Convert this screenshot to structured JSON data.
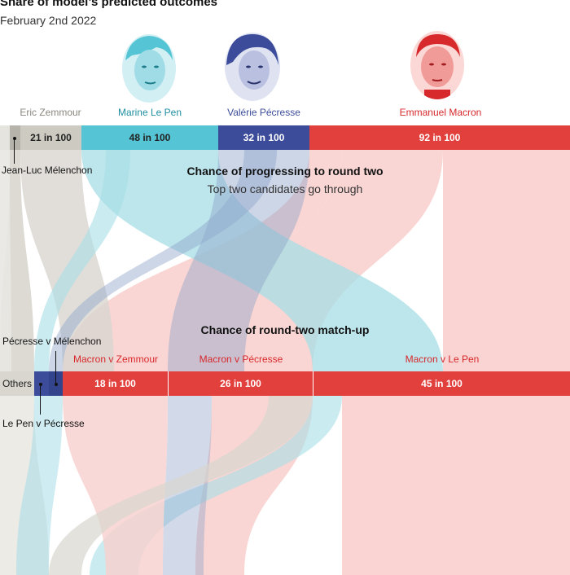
{
  "header": {
    "title": "Share of model’s predicted outcomes",
    "subtitle": "February 2nd 2022"
  },
  "colors": {
    "zemmour": "#cdcac2",
    "melenchon": "#b6b3ab",
    "lepen": "#55c4d4",
    "pecresse": "#3c4c9a",
    "macron": "#e2403d",
    "flow_lepen": "#a6dde6",
    "flow_macron": "#f8cfcd",
    "flow_zemmour": "#d9d6cf",
    "label_red": "#d7282b"
  },
  "candidates": [
    {
      "name": "Eric Zemmour",
      "color": "#8a877e"
    },
    {
      "name": "Marine Le Pen",
      "color": "#1e8fa1",
      "icon": "lepen-portrait-icon"
    },
    {
      "name": "Valérie Pécresse",
      "color": "#3c4c9a",
      "icon": "pecresse-portrait-icon"
    },
    {
      "name": "Emmanuel Macron",
      "color": "#d7282b",
      "icon": "macron-portrait-icon"
    }
  ],
  "round_one_bars": [
    {
      "label": "21 in 100"
    },
    {
      "label": "48 in 100"
    },
    {
      "label": "32 in 100"
    },
    {
      "label": "92 in 100"
    }
  ],
  "annotations": {
    "melenchon": "Jean-Luc Mélenchon",
    "pecresse_v_melenchon": "Pécresse v Mélenchon",
    "others": "Others",
    "lepen_v_pecresse": "Le Pen v Pécresse"
  },
  "section_round_two": {
    "title": "Chance of progressing to round two",
    "subtitle": "Top two candidates go through"
  },
  "section_matchup": {
    "title": "Chance of round-two match-up"
  },
  "matchups": [
    {
      "label": "Macron v Zemmour",
      "bar": "18 in 100"
    },
    {
      "label": "Macron v Pécresse",
      "bar": "26 in 100"
    },
    {
      "label": "Macron v Le Pen",
      "bar": "45 in 100"
    }
  ],
  "chart_data": {
    "type": "bar",
    "title": "Share of model’s predicted outcomes",
    "subtitle": "February 2nd 2022",
    "round_two_chance": {
      "categories": [
        "Eric Zemmour",
        "Marine Le Pen",
        "Valérie Pécresse",
        "Emmanuel Macron"
      ],
      "values": [
        21,
        48,
        32,
        92
      ],
      "unit": "in 100"
    },
    "matchup_chance": {
      "categories": [
        "Macron v Zemmour",
        "Macron v Pécresse",
        "Macron v Le Pen"
      ],
      "values": [
        18,
        26,
        45
      ],
      "unit": "in 100"
    }
  }
}
